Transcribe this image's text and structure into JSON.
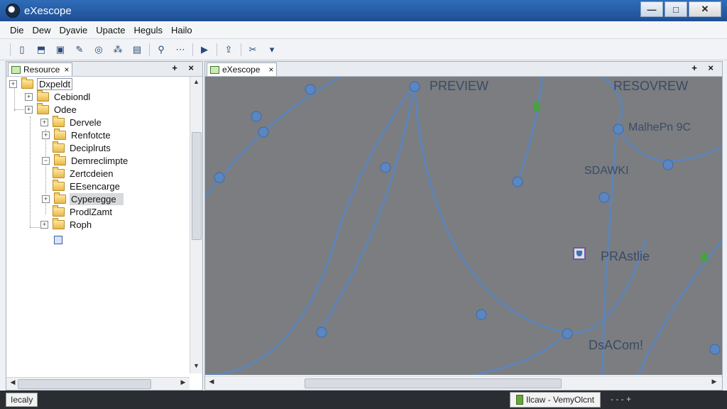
{
  "window": {
    "title": "eXescope"
  },
  "titlebar_buttons": {
    "minimize": "—",
    "maximize": "□",
    "close": "✕"
  },
  "menu": [
    "Die",
    "Dew",
    "Dyavie",
    "Upacte",
    "Heguls",
    "Hailo"
  ],
  "toolbar": {
    "icons": [
      "new-file-icon",
      "open-icon",
      "save-icon",
      "edit-icon",
      "find-icon",
      "bookmark-icon",
      "document-icon",
      "zoom-icon",
      "options-icon",
      "run-icon",
      "export-icon",
      "scissors-icon"
    ]
  },
  "left_pane": {
    "tab": "Resource",
    "controls": "+ ×",
    "tree": [
      {
        "label": "Dxpeldt",
        "depth": 0
      },
      {
        "label": "Cebiondl",
        "depth": 1
      },
      {
        "label": "Odee",
        "depth": 1
      },
      {
        "label": "Dervele",
        "depth": 2
      },
      {
        "label": "Renfotcte",
        "depth": 3
      },
      {
        "label": "Deciplruts",
        "depth": 3
      },
      {
        "label": "Demreclimpte",
        "depth": 3
      },
      {
        "label": "Zertcdeien",
        "depth": 3
      },
      {
        "label": "EEsencarge",
        "depth": 3
      },
      {
        "label": "Cyperegge",
        "depth": 3
      },
      {
        "label": "ProdlZamt",
        "depth": 3
      },
      {
        "label": "Roph",
        "depth": 2
      }
    ]
  },
  "right_pane": {
    "tab": "eXescope",
    "controls": "+ ×",
    "labels": {
      "preview": "PREVIEW",
      "resovrew": "RESOVREW",
      "mahere": "MalhePn 9C",
      "sdawki": "SDAWKI",
      "prastlie": "PRAstlie",
      "dsacom": "DsACom!"
    }
  },
  "status": {
    "left": "Iecaly",
    "right": "Ilcaw - VemyOlcnt",
    "extra": "- - -   +"
  },
  "colors": {
    "titlebar": "#2f6db8",
    "map_background": "#7b7d80",
    "route": "#5a86c2"
  }
}
